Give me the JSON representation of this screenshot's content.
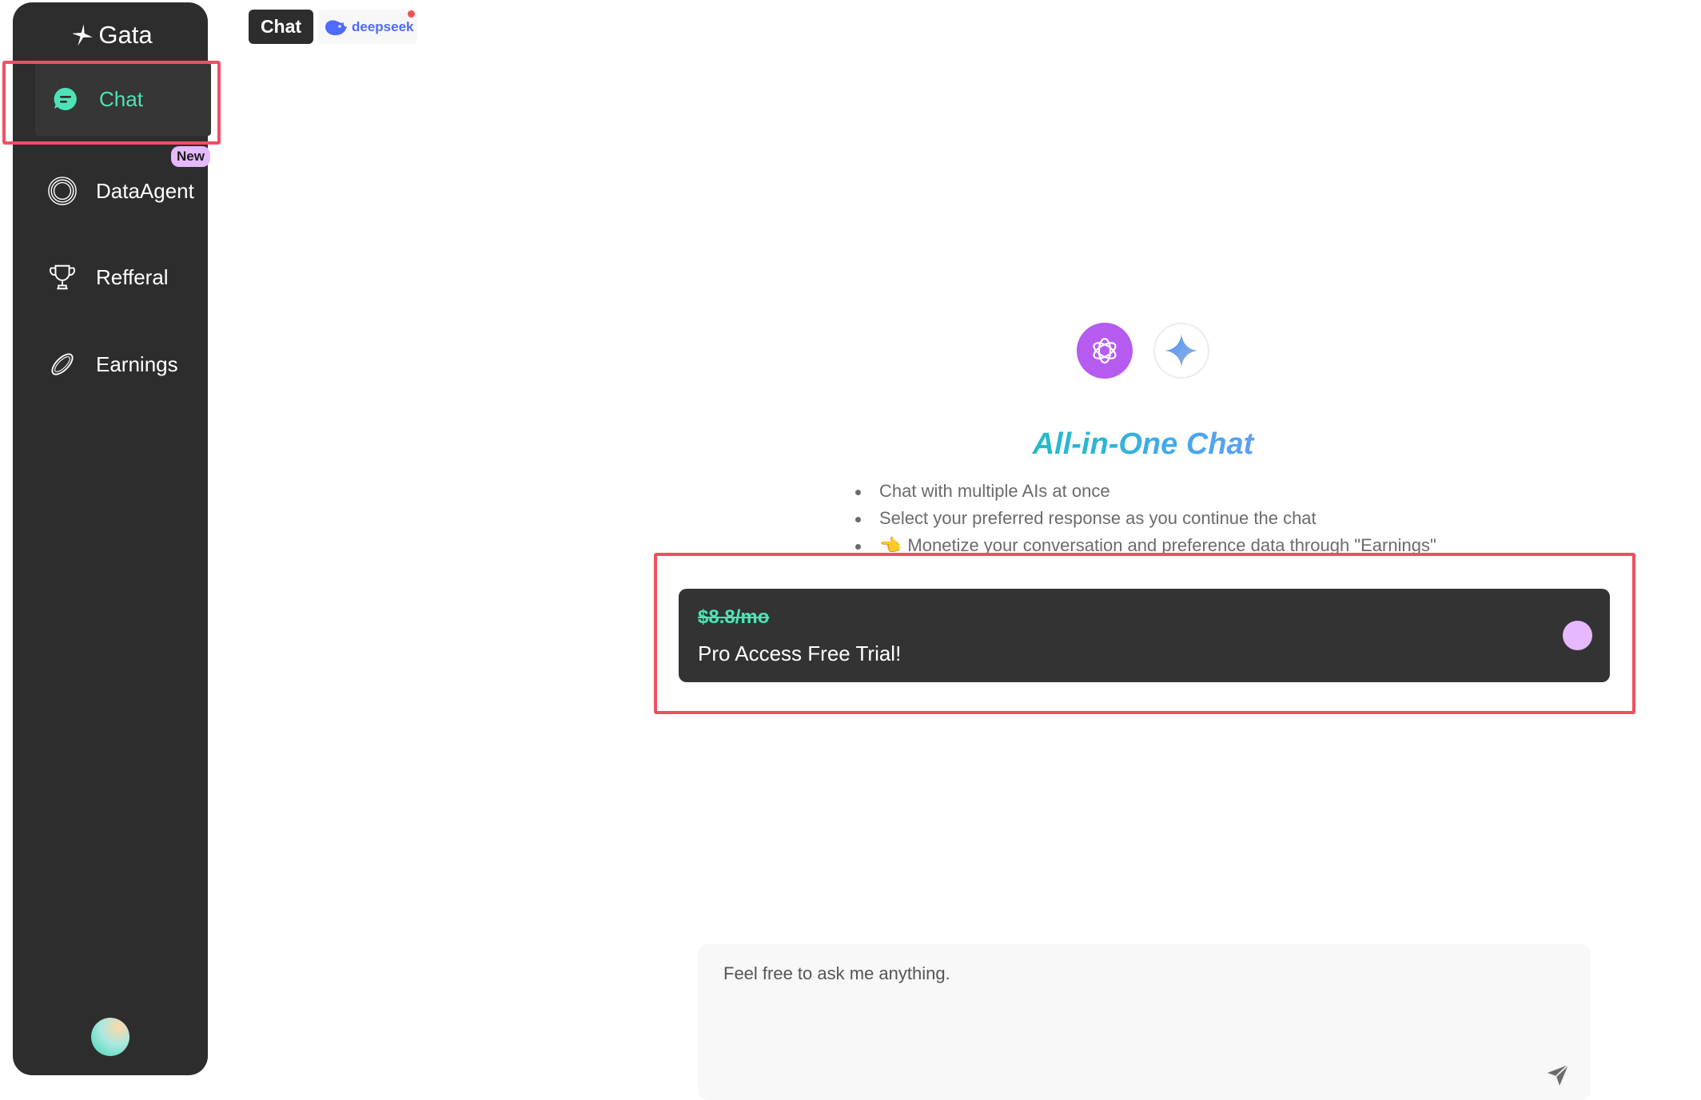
{
  "sidebar": {
    "brand": "Gata",
    "items": [
      {
        "label": "Chat",
        "icon": "chat-bubble-icon",
        "active": true
      },
      {
        "label": "DataAgent",
        "icon": "data-agent-ring-icon",
        "badge": "New"
      },
      {
        "label": "Refferal",
        "icon": "trophy-icon"
      },
      {
        "label": "Earnings",
        "icon": "coin-icon"
      }
    ],
    "avatar": "user-avatar"
  },
  "top_tabs": {
    "chat_label": "Chat",
    "deepseek_label": "deepseek",
    "deepseek_icon": "deepseek-whale-icon"
  },
  "hero": {
    "logos": [
      "openai-icon",
      "gemini-sparkle-icon"
    ],
    "title": "All-in-One Chat",
    "features": [
      {
        "text": "Chat with multiple AIs at once"
      },
      {
        "text": "Select your preferred response as you continue the chat"
      },
      {
        "emoji": "👈",
        "text": "Monetize your conversation and preference data through \"Earnings\""
      }
    ]
  },
  "promo": {
    "old_price": "$8.8/mo",
    "text": "Pro Access Free Trial!"
  },
  "input": {
    "placeholder": "Feel free to ask me anything.",
    "send_icon": "send-icon"
  },
  "colors": {
    "accent": "#4ee3b6",
    "sidebar_bg": "#2d2d2d",
    "highlight": "#ef4f62",
    "badge_bg": "#e6b8ff"
  }
}
